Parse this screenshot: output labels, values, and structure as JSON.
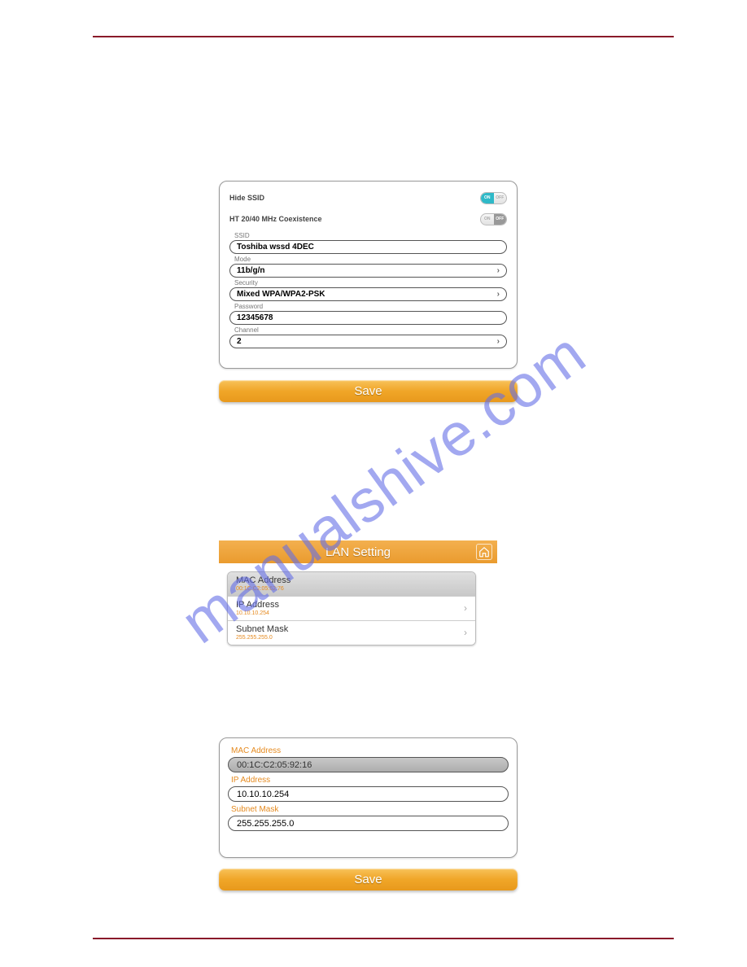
{
  "watermark": "manualshive.com",
  "wireless": {
    "hide_ssid_label": "Hide SSID",
    "hide_ssid_on": true,
    "coex_label": "HT 20/40 MHz Coexistence",
    "coex_on": false,
    "ssid_label": "SSID",
    "ssid_value": "Toshiba wssd 4DEC",
    "mode_label": "Mode",
    "mode_value": "11b/g/n",
    "security_label": "Security",
    "security_value": "Mixed WPA/WPA2-PSK",
    "password_label": "Password",
    "password_value": "12345678",
    "channel_label": "Channel",
    "channel_value": "2",
    "toggle_on": "ON",
    "toggle_off": "OFF"
  },
  "save_label": "Save",
  "lan_header": {
    "title": "LAN Setting"
  },
  "lan_list": {
    "mac_label": "MAC Address",
    "mac_value": "00:1C:C2:05:62:76",
    "ip_label": "IP Address",
    "ip_value": "10.10.10.254",
    "mask_label": "Subnet Mask",
    "mask_value": "255.255.255.0"
  },
  "lan_edit": {
    "mac_label": "MAC Address",
    "mac_value": "00:1C:C2:05:92:16",
    "ip_label": "IP Address",
    "ip_value": "10.10.10.254",
    "mask_label": "Subnet Mask",
    "mask_value": "255.255.255.0"
  }
}
